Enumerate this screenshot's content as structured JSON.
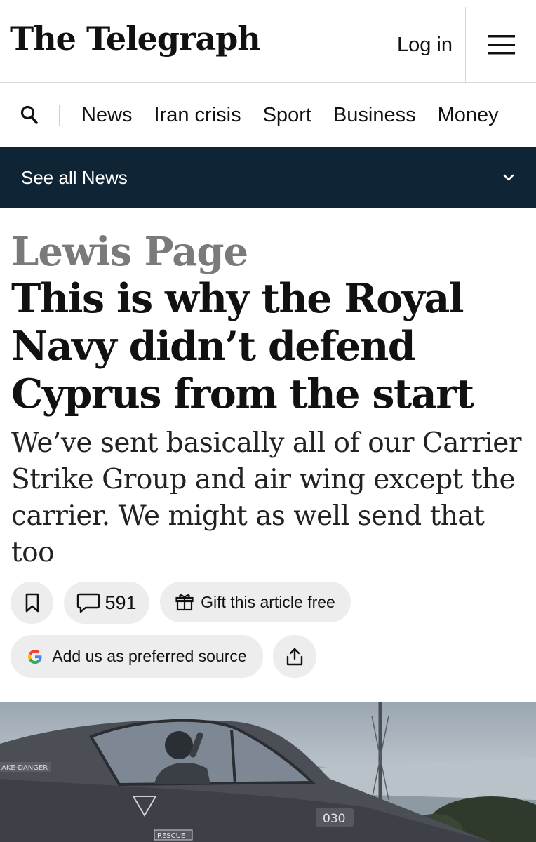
{
  "header": {
    "logo_text": "The Telegraph",
    "login_label": "Log in",
    "menu_icon": "hamburger-icon"
  },
  "nav": {
    "search_icon": "search-icon",
    "items": [
      "News",
      "Iran crisis",
      "Sport",
      "Business",
      "Money"
    ]
  },
  "section": {
    "label": "See all News",
    "chevron_icon": "chevron-down-icon",
    "bg_color": "#0f2536"
  },
  "article": {
    "author": "Lewis Page",
    "headline": "This is why the Royal Navy didn’t defend Cyprus from the start",
    "standfirst": "We’ve sent basically all of our Carrier Strike Group and air wing except the carrier. We might as well send that too",
    "actions": {
      "bookmark_icon": "bookmark-icon",
      "comments_count": "591",
      "comments_icon": "comment-icon",
      "gift_label": "Gift this article free",
      "gift_icon": "gift-icon",
      "preferred_source_label": "Add us as preferred source",
      "google_icon": "google-g-icon",
      "share_icon": "share-icon"
    }
  },
  "hero_image": {
    "markings": [
      "AKE-DANGER",
      "030",
      "RESCUE"
    ]
  }
}
